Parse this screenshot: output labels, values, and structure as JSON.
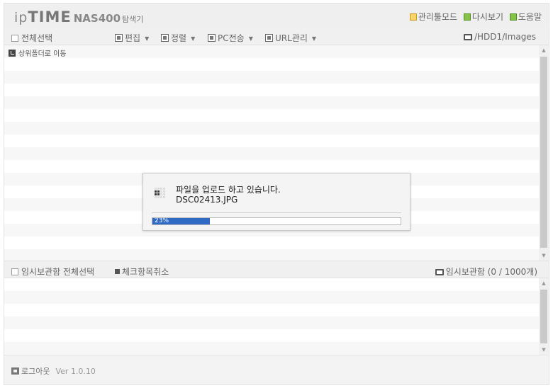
{
  "header": {
    "logo_ip": "ip",
    "logo_time": "TIME",
    "logo_model": "NAS400",
    "logo_suffix": "탐색기",
    "links": [
      {
        "label": "관리툴모드",
        "icon": "admin-tool-icon",
        "color": "#f7d36a"
      },
      {
        "label": "다시보기",
        "icon": "refresh-icon",
        "color": "#86c24a"
      },
      {
        "label": "도움말",
        "icon": "help-icon",
        "color": "#86c24a"
      }
    ]
  },
  "toolbar": {
    "select_all": "전체선택",
    "menus": [
      "편집",
      "정렬",
      "PC전송",
      "URL관리"
    ],
    "path": "/HDD1/Images"
  },
  "file_list": {
    "up_label": "상위폴더로 이동"
  },
  "temp_bar": {
    "select_all": "임시보관함 전체선택",
    "cancel_checked": "체크항목취소",
    "storage_label": "임시보관함 (0 / 1000개)"
  },
  "footer": {
    "logout": "로그아웃",
    "version": "Ver 1.0.10"
  },
  "dialog": {
    "message": "파일을 업로드 하고 있습니다.",
    "filename": "DSC02413.JPG",
    "progress_percent": 23,
    "progress_label": "23%",
    "progress_color": "#2f6ac5"
  }
}
